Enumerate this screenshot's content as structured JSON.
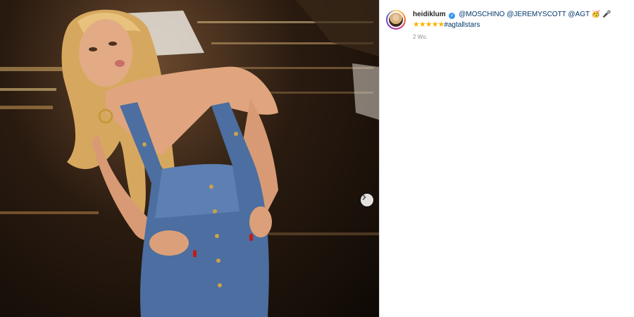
{
  "post": {
    "media_alt": "Photo post image",
    "next_button_label": "Next"
  },
  "caption": {
    "username": "heidiklum",
    "mentions": [
      "@MOSCHINO",
      "@JEREMYSCOTT",
      "@AGT"
    ],
    "emoji_1": "🥳",
    "emoji_2": "🎤",
    "stars": "★★★★★",
    "hashtag": "#agtallstars"
  },
  "meta": {
    "timestamp": "2 Wo."
  },
  "icons": {
    "verified": "verified-badge-icon",
    "next": "chevron-right-icon"
  },
  "colors": {
    "mention": "#00376b",
    "verified": "#3897f0",
    "timestamp": "#8e8e8e"
  }
}
